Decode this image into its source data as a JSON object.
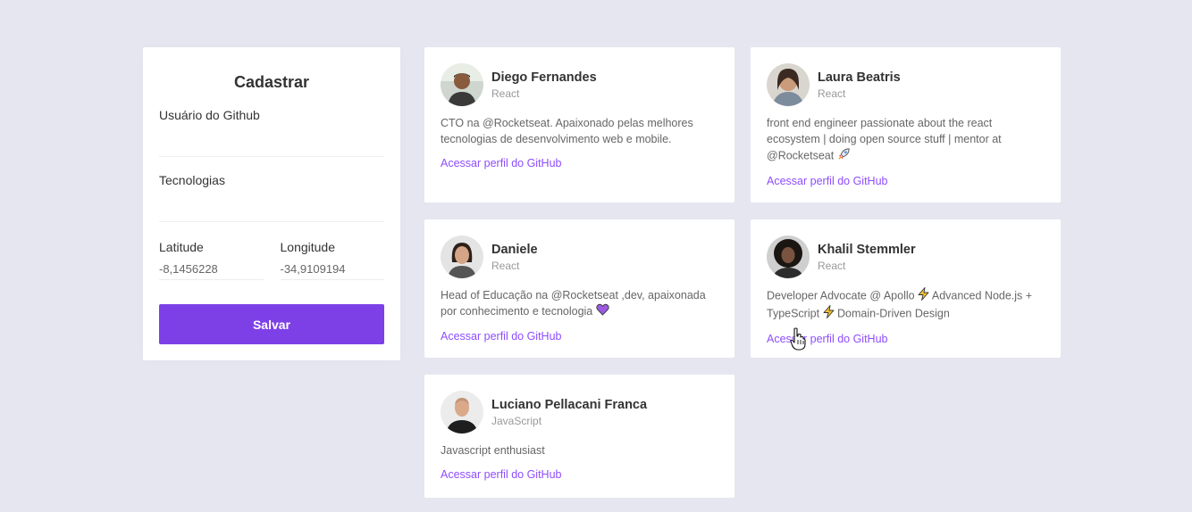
{
  "form": {
    "title": "Cadastrar",
    "github_user_label": "Usuário do Github",
    "github_user_value": "",
    "techs_label": "Tecnologias",
    "techs_value": "",
    "latitude_label": "Latitude",
    "latitude_value": "-8,1456228",
    "longitude_label": "Longitude",
    "longitude_value": "-34,9109194",
    "save_label": "Salvar"
  },
  "devs": [
    {
      "name": "Diego Fernandes",
      "techs": "React",
      "bio": "CTO na @Rocketseat. Apaixonado pelas melhores tecnologias de desenvolvimento web e mobile.",
      "link": "Acessar perfil do GitHub"
    },
    {
      "name": "Laura Beatris",
      "techs": "React",
      "bio": "front end engineer passionate about the react ecosystem | doing open source stuff | mentor at @Rocketseat",
      "link": "Acessar perfil do GitHub"
    },
    {
      "name": "Daniele",
      "techs": "React",
      "bio": "Head of Educação na @Rocketseat ,dev, apaixonada por conhecimento e tecnologia",
      "link": "Acessar perfil do GitHub"
    },
    {
      "name": "Khalil Stemmler",
      "techs": "React",
      "bio_parts": [
        "Developer Advocate @ Apollo",
        "Advanced Node.js +",
        "TypeScript",
        "Domain-Driven Design"
      ],
      "link": "Acessar perfil do GitHub"
    },
    {
      "name": "Luciano Pellacani Franca",
      "techs": "JavaScript",
      "bio": "Javascript enthusiast",
      "link": "Acessar perfil do GitHub"
    }
  ],
  "colors": {
    "background": "#e6e6f0",
    "accent": "#7d40e7",
    "link": "#8e4dff"
  },
  "icons": [
    "rocket-emoji-icon",
    "purple-heart-emoji-icon",
    "lightning-emoji-icon",
    "hand-pointer-cursor-icon"
  ]
}
